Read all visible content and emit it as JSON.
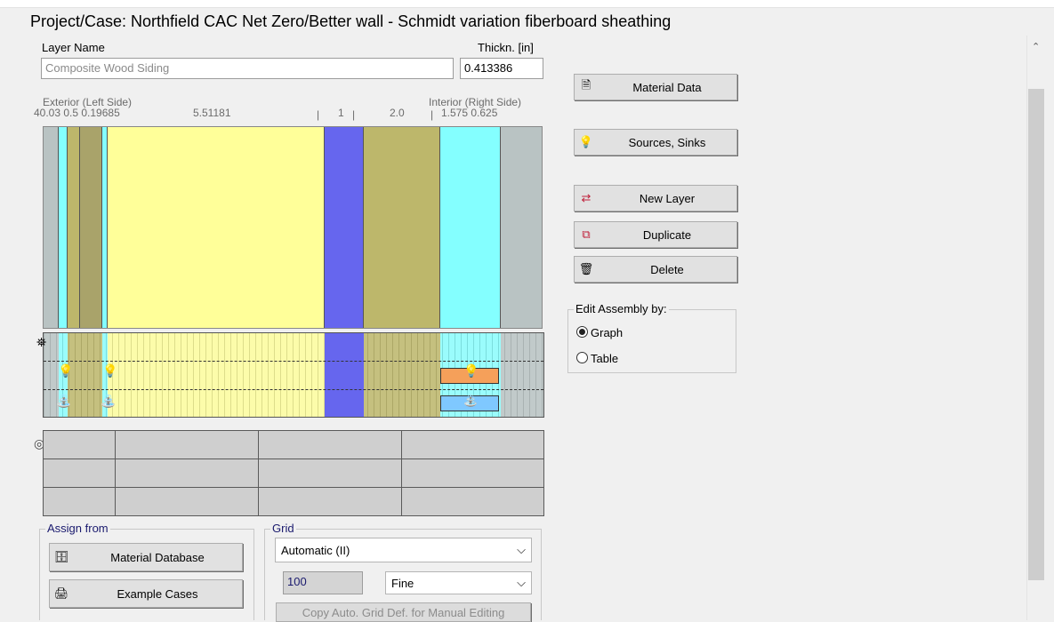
{
  "project": {
    "title": "Project/Case:  Northfield CAC Net Zero/Better wall - Schmidt variation fiberboard sheathing"
  },
  "layer_name_label": "Layer Name",
  "thickness_label": "Thickn. [in]",
  "layer_name_value": "Composite Wood Siding",
  "thickness_value": "0.413386",
  "exterior_label": "Exterior (Left Side)",
  "interior_label": "Interior (Right Side)",
  "ruler": {
    "left": "40.03 0.5 0.19685",
    "mid": "5.51181",
    "one": "1",
    "two": "2.0",
    "right": "1.575  0.625"
  },
  "buttons": {
    "material_data": "Material Data",
    "sources_sinks": "Sources, Sinks",
    "new_layer": "New Layer",
    "duplicate": "Duplicate",
    "delete": "Delete",
    "material_database": "Material Database",
    "example_cases": "Example Cases",
    "copy_grid": "Copy Auto. Grid Def. for Manual Editing"
  },
  "edit_assembly": {
    "caption": "Edit Assembly by:",
    "options": [
      "Graph",
      "Table"
    ],
    "selected": "Graph"
  },
  "assign_from": {
    "caption": "Assign from"
  },
  "grid": {
    "caption": "Grid",
    "mode_value": "Automatic (II)",
    "count_value": "100",
    "resolution_value": "Fine"
  },
  "icons": {
    "material_data": "document-icon",
    "sources_sinks": "bulb-faucet-icon",
    "new_layer": "new-layer-icon",
    "duplicate": "duplicate-icon",
    "delete": "trash-icon",
    "material_database": "database-icon",
    "example_cases": "example-icon"
  },
  "colors": {
    "gray_layer": "#b9c3c3",
    "cyan_layer": "#84ffff",
    "olive_layer": "#bdb76b",
    "yellow_layer": "#ffff99",
    "blue_layer": "#6666ee",
    "orange_source": "#f5a05a",
    "blue_sink": "#7fc8ff"
  }
}
